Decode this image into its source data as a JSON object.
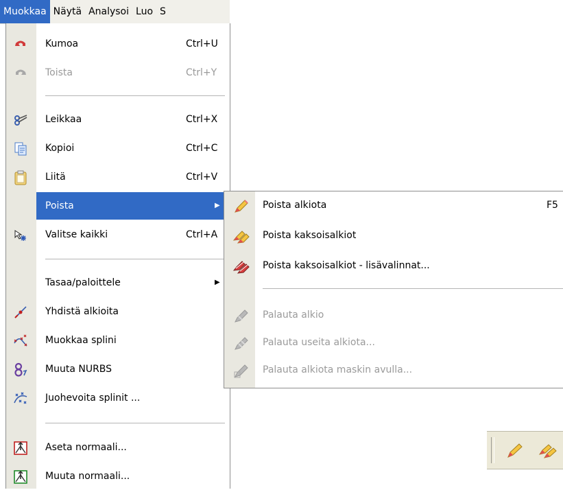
{
  "menubar": {
    "items": [
      "Muokkaa",
      "Näytä",
      "Analysoi",
      "Luo",
      "S"
    ]
  },
  "menu": {
    "items": [
      {
        "label": "Kumoa",
        "shortcut": "Ctrl+U",
        "icon": "undo-icon"
      },
      {
        "label": "Toista",
        "shortcut": "Ctrl+Y",
        "icon": "redo-icon",
        "disabled": true
      },
      {
        "label": "Leikkaa",
        "shortcut": "Ctrl+X",
        "icon": "scissors-icon"
      },
      {
        "label": "Kopioi",
        "shortcut": "Ctrl+C",
        "icon": "copy-icon"
      },
      {
        "label": "Liitä",
        "shortcut": "Ctrl+V",
        "icon": "paste-icon"
      },
      {
        "label": "Poista",
        "submenu": true
      },
      {
        "label": "Valitse kaikki",
        "shortcut": "Ctrl+A",
        "icon": "select-all-icon"
      },
      {
        "label": "Tasaa/paloittele",
        "submenu": true
      },
      {
        "label": "Yhdistä alkioita",
        "icon": "join-icon"
      },
      {
        "label": "Muokkaa splini",
        "icon": "spline-icon"
      },
      {
        "label": "Muuta NURBS",
        "icon": "nurbs-icon"
      },
      {
        "label": "Juohevoita splinit ...",
        "icon": "smooth-icon"
      },
      {
        "label": "Aseta normaali...",
        "icon": "normal-red-icon"
      },
      {
        "label": "Muuta normaali...",
        "icon": "normal-green-icon"
      }
    ]
  },
  "submenu": {
    "items": [
      {
        "label": "Poista alkiota",
        "shortcut": "F5",
        "icon": "pencil-eraser-icon"
      },
      {
        "label": "Poista kaksoisalkiot",
        "icon": "double-eraser-icon"
      },
      {
        "label": "Poista kaksoisalkiot  - lisävalinnat...",
        "icon": "double-eraser-red-icon"
      },
      {
        "label": "Palauta alkio",
        "disabled": true,
        "icon": "restore-icon"
      },
      {
        "label": "Palauta useita alkiota...",
        "disabled": true,
        "icon": "restore-many-icon"
      },
      {
        "label": "Palauta alkiota maskin avulla...",
        "disabled": true,
        "icon": "restore-mask-icon"
      }
    ]
  },
  "colors": {
    "highlight": "#316ac5",
    "gutter": "#e9e8e0",
    "disabled_text": "#9a9a9a"
  }
}
